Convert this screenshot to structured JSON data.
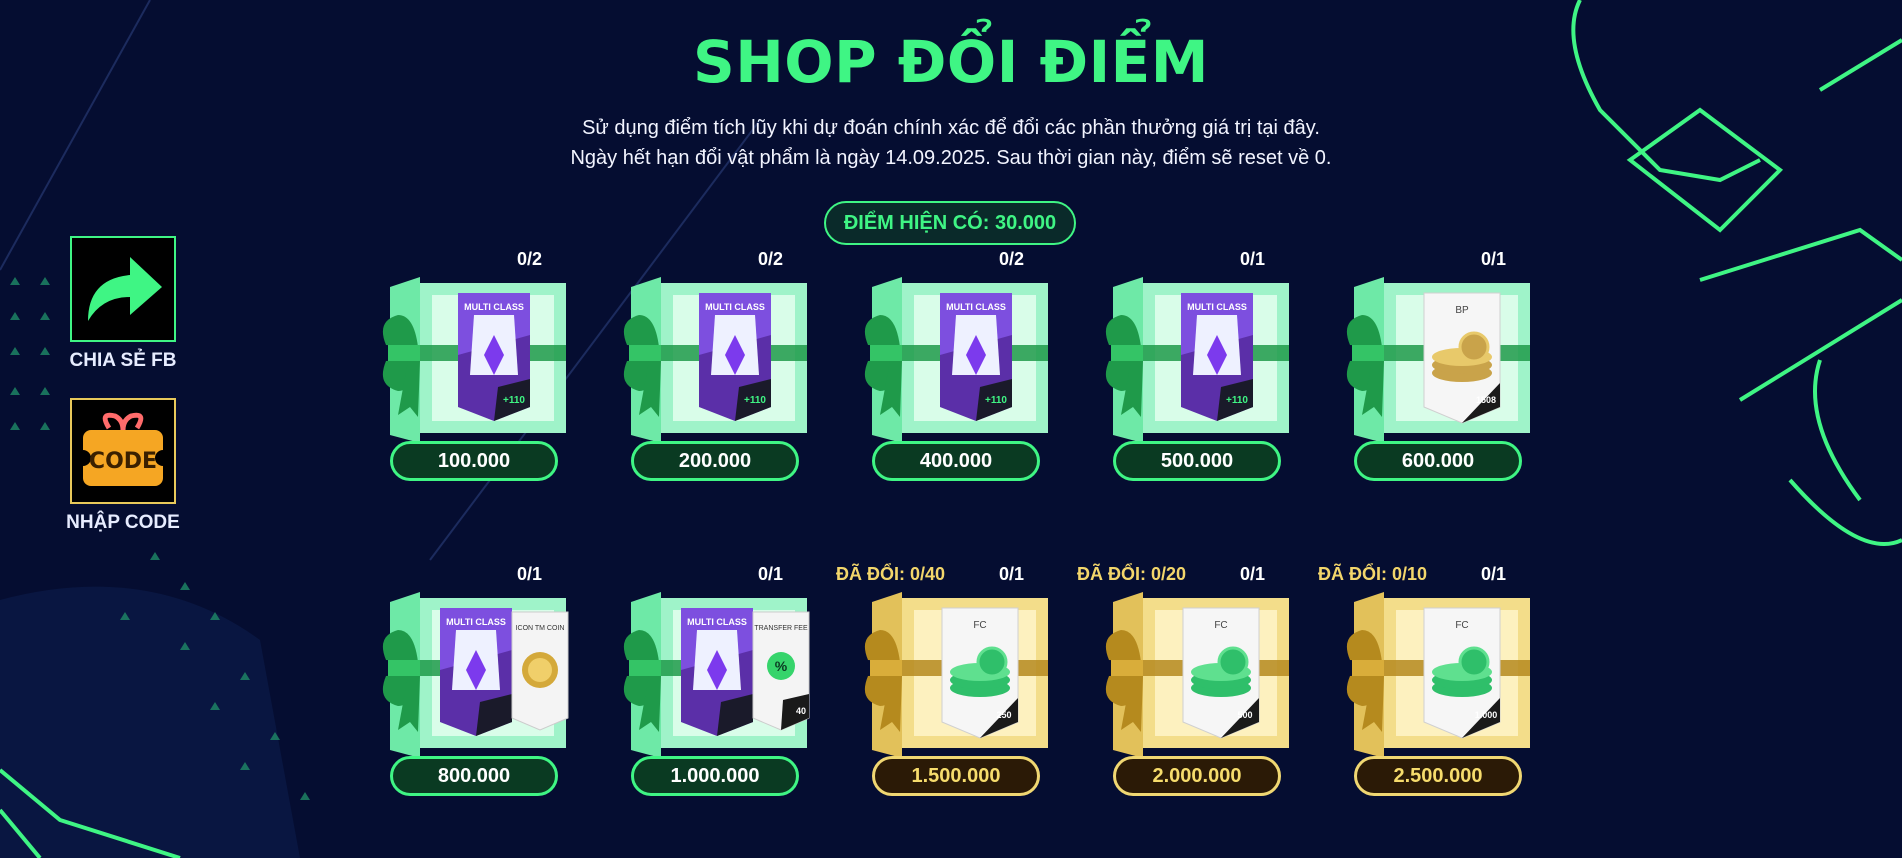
{
  "title": "SHOP ĐỔI ĐIỂM",
  "description": [
    "Sử dụng điểm tích lũy khi dự đoán chính xác để đổi các phần thưởng giá trị tại đây.",
    "Ngày hết hạn đổi vật phẩm là ngày 14.09.2025. Sau thời gian này, điểm sẽ reset về 0."
  ],
  "points_label": "ĐIỂM HIỆN CÓ: 30.000",
  "side": {
    "share_label": "CHIA SẺ FB",
    "code_label": "NHẬP CODE",
    "code_icon_text": "CODE"
  },
  "items": [
    {
      "count": "0/2",
      "price": "100.000",
      "card": "MULTI CLASS",
      "card_value": "+110",
      "theme": "green"
    },
    {
      "count": "0/2",
      "price": "200.000",
      "card": "MULTI CLASS",
      "card_value": "+110",
      "theme": "green"
    },
    {
      "count": "0/2",
      "price": "400.000",
      "card": "MULTI CLASS",
      "card_value": "+110",
      "theme": "green"
    },
    {
      "count": "0/1",
      "price": "500.000",
      "card": "MULTI CLASS",
      "card_value": "+110",
      "theme": "green"
    },
    {
      "count": "0/1",
      "price": "600.000",
      "card": "BP",
      "card_value": "1508",
      "theme": "green"
    },
    {
      "count": "0/1",
      "price": "800.000",
      "card": "MULTI CLASS",
      "card2": "ICON TM COIN",
      "theme": "green"
    },
    {
      "count": "0/1",
      "price": "1.000.000",
      "card": "MULTI CLASS",
      "card2": "TRANSFER FEE",
      "card2_value": "40",
      "theme": "green"
    },
    {
      "count": "0/1",
      "redeemed": "ĐÃ ĐỔI: 0/40",
      "price": "1.500.000",
      "card": "FC",
      "card_value": "250",
      "theme": "gold"
    },
    {
      "count": "0/1",
      "redeemed": "ĐÃ ĐỔI: 0/20",
      "price": "2.000.000",
      "card": "FC",
      "card_value": "500",
      "theme": "gold"
    },
    {
      "count": "0/1",
      "redeemed": "ĐÃ ĐỔI: 0/10",
      "price": "2.500.000",
      "card": "FC",
      "card_value": "1.000",
      "theme": "gold"
    }
  ],
  "colors": {
    "background": "#050d31",
    "accent_green": "#3ff584",
    "accent_gold": "#f0d772"
  }
}
